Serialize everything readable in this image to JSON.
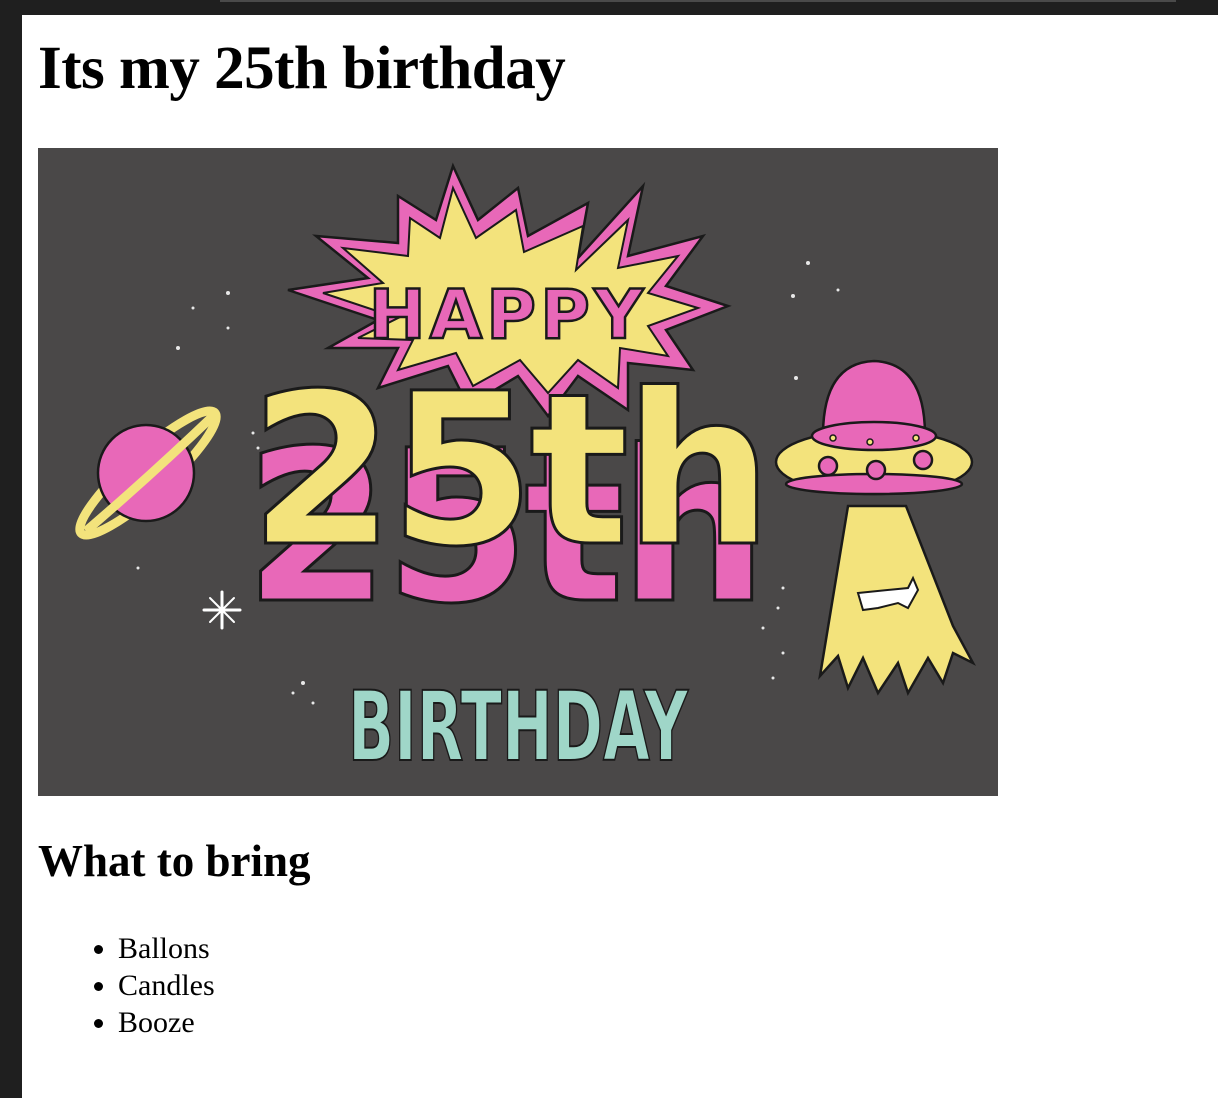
{
  "page": {
    "title": "Its my 25th birthday",
    "section_heading": "What to bring",
    "items": [
      "Ballons",
      "Candles",
      "Booze"
    ]
  },
  "banner": {
    "top_word": "HAPPY",
    "number_word": "25th",
    "bottom_word": "BIRTHDAY",
    "colors": {
      "background": "#4a4848",
      "pink": "#e868b8",
      "yellow": "#f3e37c",
      "mint": "#9fd6c8",
      "outline": "#1a1a1a"
    }
  }
}
